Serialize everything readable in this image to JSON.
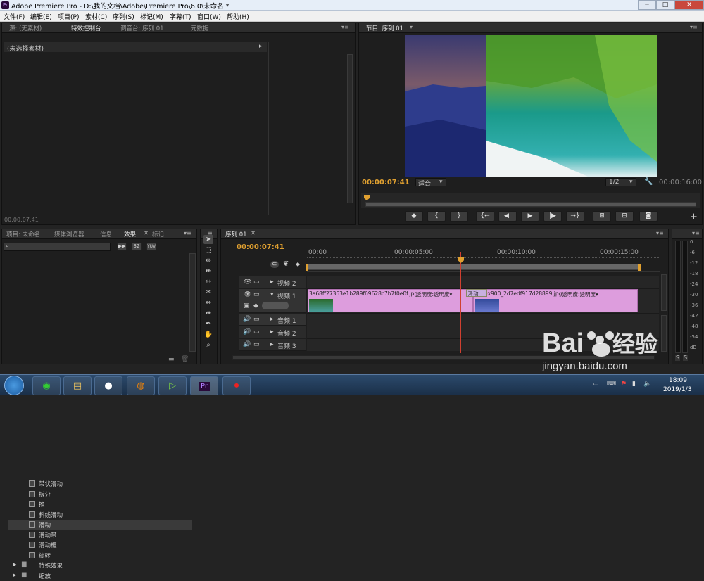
{
  "window": {
    "title": "Adobe Premiere Pro - D:\\我的文档\\Adobe\\Premiere Pro\\6.0\\未命名 *",
    "app_icon": "Pr",
    "min": "─",
    "max": "□",
    "close": "✕"
  },
  "menu": [
    "文件(F)",
    "编辑(E)",
    "项目(P)",
    "素材(C)",
    "序列(S)",
    "标记(M)",
    "字幕(T)",
    "窗口(W)",
    "帮助(H)"
  ],
  "source_panel": {
    "tabs": [
      "源: (无素材)",
      "特效控制台",
      "调音台: 序列 01",
      "元数据"
    ],
    "active_tab": 1,
    "no_clip": "(未选择素材)",
    "timecode": "00:00:07:41"
  },
  "program_panel": {
    "tab": "节目: 序列 01",
    "timecode": "00:00:07:41",
    "fit": "适合",
    "resolution": "1/2",
    "duration": "00:00:16:00",
    "buttons": [
      "◆",
      "{",
      "}",
      "{←",
      "◀|",
      "▶",
      "|▶",
      "→}",
      "⊞",
      "⊟",
      "◙"
    ],
    "add": "+"
  },
  "project_panel": {
    "tabs": [
      "项目: 未命名",
      "媒体浏览器",
      "信息",
      "效果",
      "标记"
    ],
    "active_tab": 3,
    "search_placeholder": "",
    "badges": [
      "32",
      "YUV"
    ],
    "items": [
      {
        "label": "带状滑动",
        "type": "effect"
      },
      {
        "label": "拆分",
        "type": "effect"
      },
      {
        "label": "推",
        "type": "effect"
      },
      {
        "label": "斜线滑动",
        "type": "effect"
      },
      {
        "label": "滑动",
        "type": "effect",
        "selected": true
      },
      {
        "label": "滑动带",
        "type": "effect"
      },
      {
        "label": "滑动框",
        "type": "effect"
      },
      {
        "label": "旋转",
        "type": "effect"
      },
      {
        "label": "特殊效果",
        "type": "folder"
      },
      {
        "label": "缩放",
        "type": "folder"
      }
    ]
  },
  "tools": [
    "selection-tool",
    "track-select-tool",
    "ripple-edit-tool",
    "rolling-edit-tool",
    "rate-stretch-tool",
    "razor-tool",
    "slip-tool",
    "slide-tool",
    "pen-tool",
    "hand-tool",
    "zoom-tool"
  ],
  "timeline": {
    "tab": "序列 01",
    "timecode": "00:00:07:41",
    "ruler": [
      "00:00",
      "00:00:05:00",
      "00:00:10:00",
      "00:00:15:00"
    ],
    "playhead": 7.41,
    "duration_seconds": 16,
    "tracks": [
      {
        "name": "视频 2",
        "kind": "video"
      },
      {
        "name": "视频 1",
        "kind": "video",
        "expanded": true
      },
      {
        "name": "音频 1",
        "kind": "audio"
      },
      {
        "name": "音频 2",
        "kind": "audio"
      },
      {
        "name": "音频 3",
        "kind": "audio"
      }
    ],
    "clips": [
      {
        "name": "3a68ff27363e1b289f69628c7b7f0e0f.jpg",
        "fx": "透明度:透明度▾",
        "start": 0,
        "end": 8,
        "color": "#dd9ddd"
      },
      {
        "name": "1440x900_2d7edf917d28899.jpg",
        "fx": "透明度:透明度▾",
        "start": 8,
        "end": 16,
        "color": "#dd9ddd"
      }
    ],
    "transition": "滑动"
  },
  "audio_meter": {
    "labels": [
      "0",
      "-6",
      "-12",
      "-18",
      "-24",
      "-30",
      "-36",
      "-42",
      "-48",
      "-54",
      "dB"
    ],
    "solo": [
      "S",
      "S"
    ]
  },
  "taskbar": {
    "clock_time": "18:09",
    "clock_date": "2019/1/3"
  },
  "watermark": {
    "text": "Baidu经验",
    "url": "jingyan.baidu.com"
  }
}
